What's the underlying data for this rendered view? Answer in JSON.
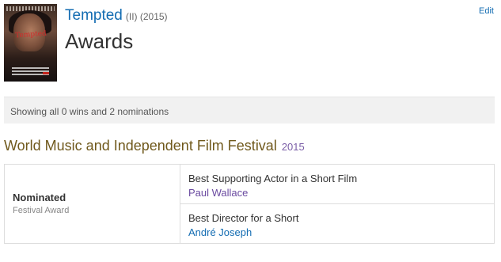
{
  "poster": {
    "title_text": "Tempted",
    "icon": "movie-poster-image"
  },
  "header": {
    "title_link": "Tempted",
    "title_meta": "(II) (2015)",
    "page_heading": "Awards",
    "edit_label": "Edit"
  },
  "summary": {
    "text": "Showing all 0 wins and 2 nominations"
  },
  "festival": {
    "name": "World Music and Independent Film Festival",
    "year": "2015"
  },
  "outcome": {
    "title": "Nominated",
    "category": "Festival Award"
  },
  "awards": [
    {
      "name": "Best Supporting Actor in a Short Film",
      "person": "Paul Wallace"
    },
    {
      "name": "Best Director for a Short",
      "person": "André Joseph"
    }
  ],
  "colors": {
    "link_blue": "#136cb2",
    "festival_brown": "#70591c",
    "year_purple": "#7b5ea7",
    "visited_purple": "#6a4aa0"
  }
}
